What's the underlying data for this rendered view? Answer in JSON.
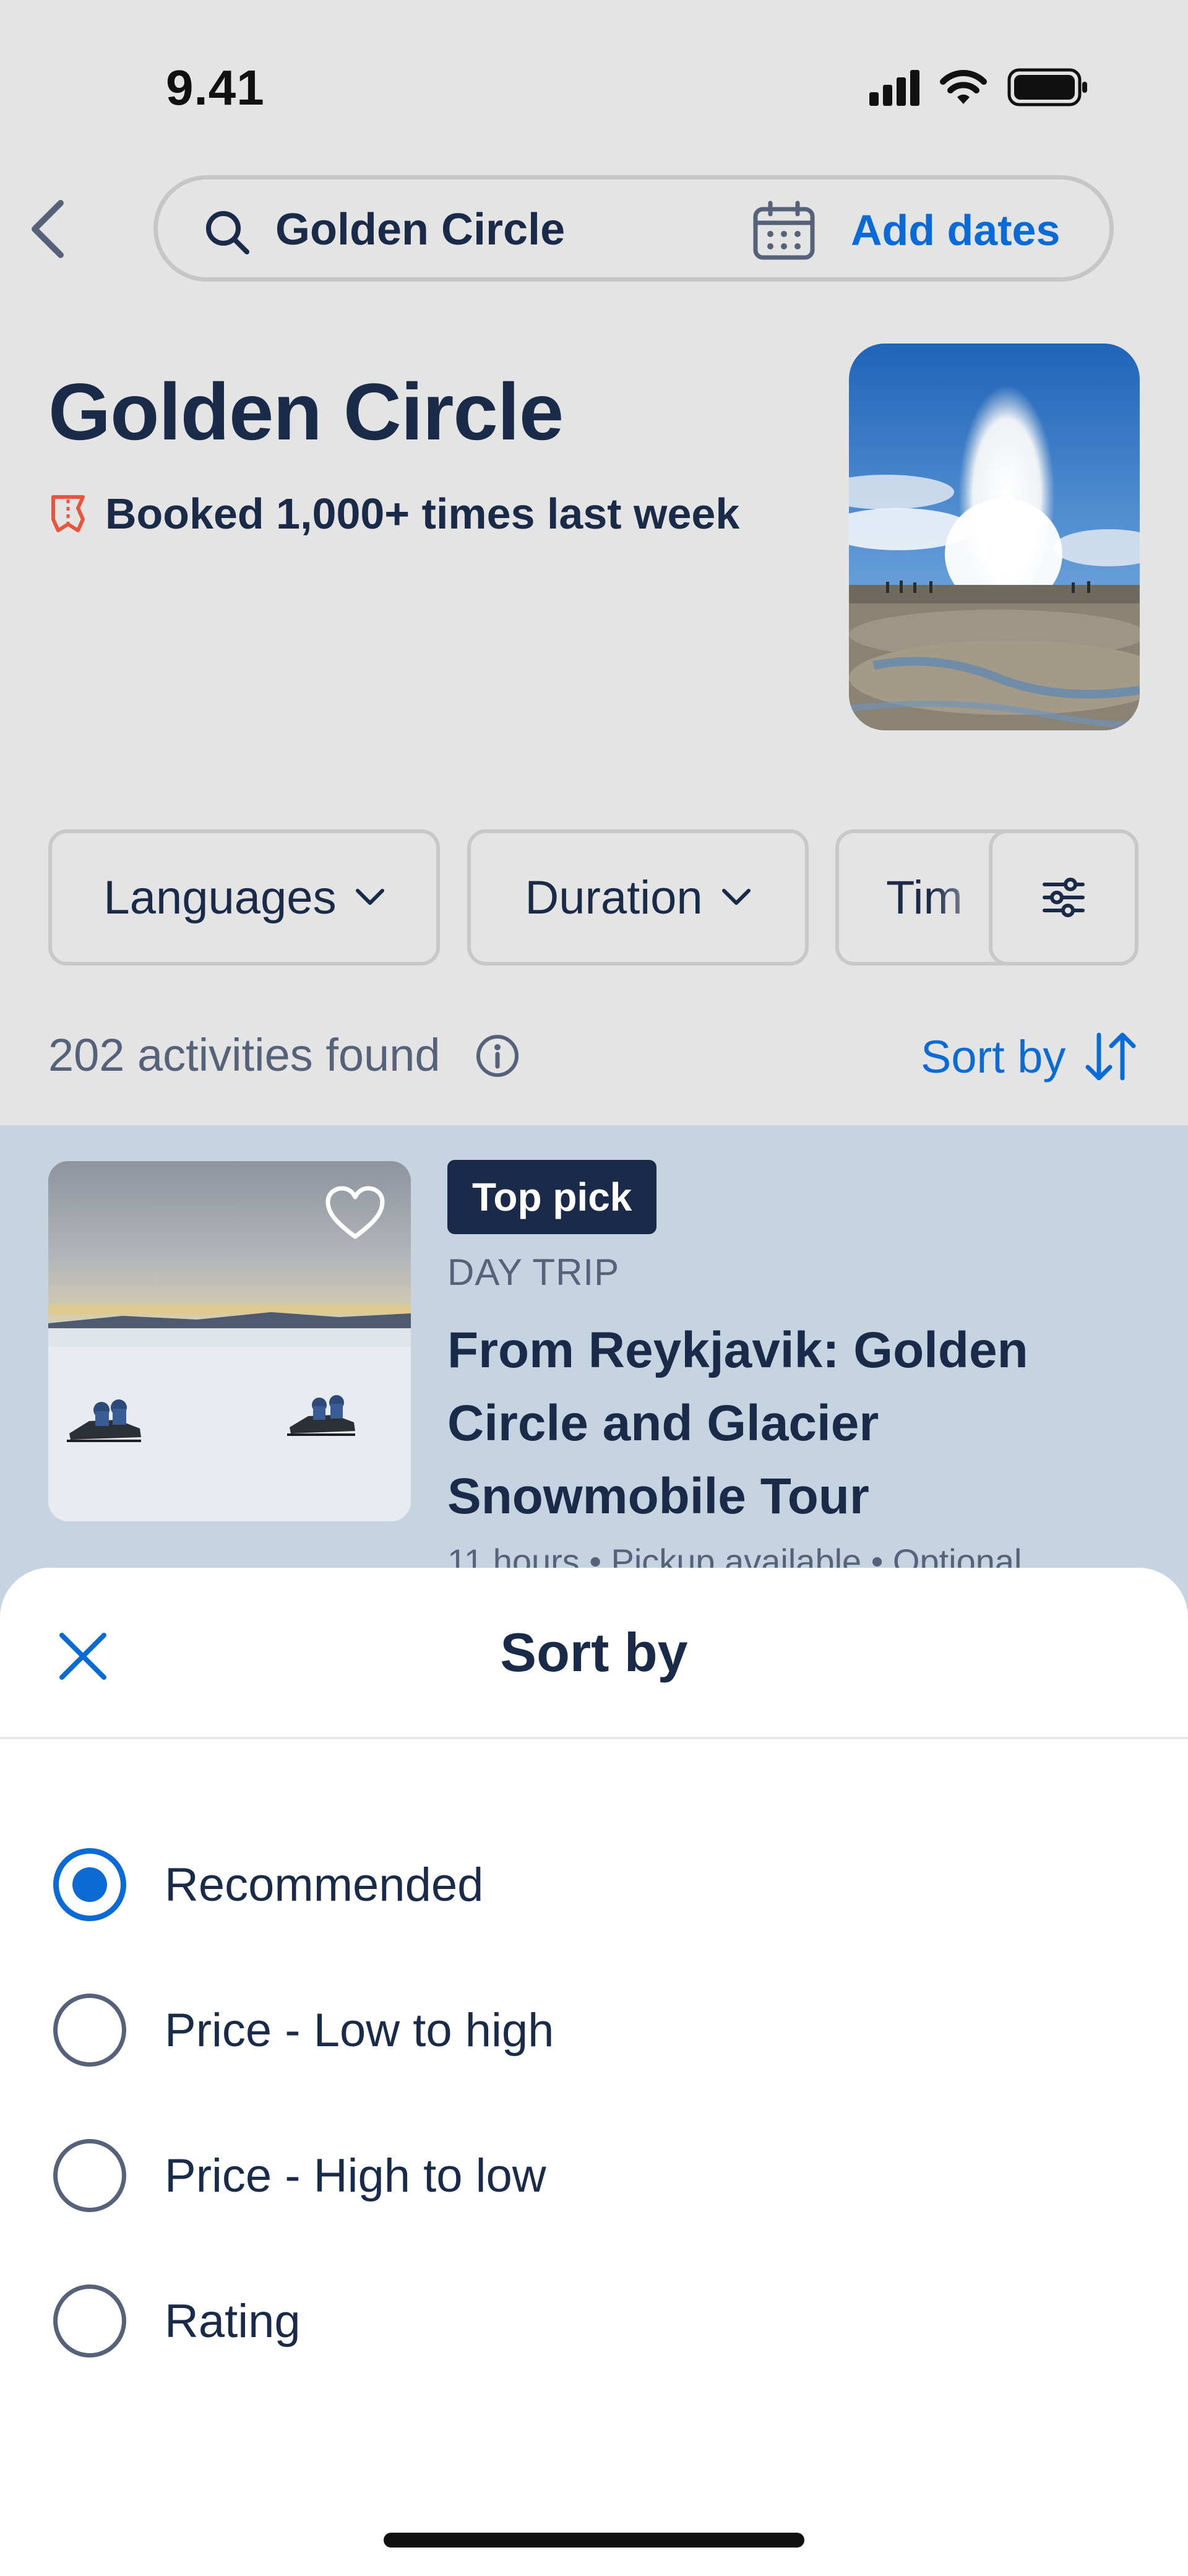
{
  "status_bar": {
    "time": "9.41"
  },
  "search": {
    "query": "Golden Circle",
    "dates_label": "Add dates"
  },
  "hero": {
    "title": "Golden Circle",
    "booked_text": "Booked 1,000+ times last week"
  },
  "filters": {
    "chips": [
      {
        "label": "Languages"
      },
      {
        "label": "Duration"
      },
      {
        "label": "Tim"
      }
    ]
  },
  "results": {
    "count_text": "202 activities found",
    "sort_label": "Sort by"
  },
  "result_card": {
    "badge": "Top pick",
    "category": "DAY TRIP",
    "title": "From Reykjavik: Golden Circle and Glacier Snowmobile Tour",
    "meta": "11 hours • Pickup available • Optional"
  },
  "sort_sheet": {
    "title": "Sort by",
    "options": [
      {
        "label": "Recommended",
        "selected": true
      },
      {
        "label": "Price - Low to high",
        "selected": false
      },
      {
        "label": "Price - High to low",
        "selected": false
      },
      {
        "label": "Rating",
        "selected": false
      }
    ]
  },
  "colors": {
    "accent": "#0a6bd6",
    "navy": "#1a2b49",
    "booked_icon": "#e8543c",
    "muted": "#56617a"
  },
  "icons": [
    "back-chevron-icon",
    "search-icon",
    "calendar-icon",
    "ticket-icon",
    "chevron-down-icon",
    "filter-sliders-icon",
    "info-icon",
    "sort-arrows-icon",
    "heart-icon",
    "close-icon"
  ]
}
